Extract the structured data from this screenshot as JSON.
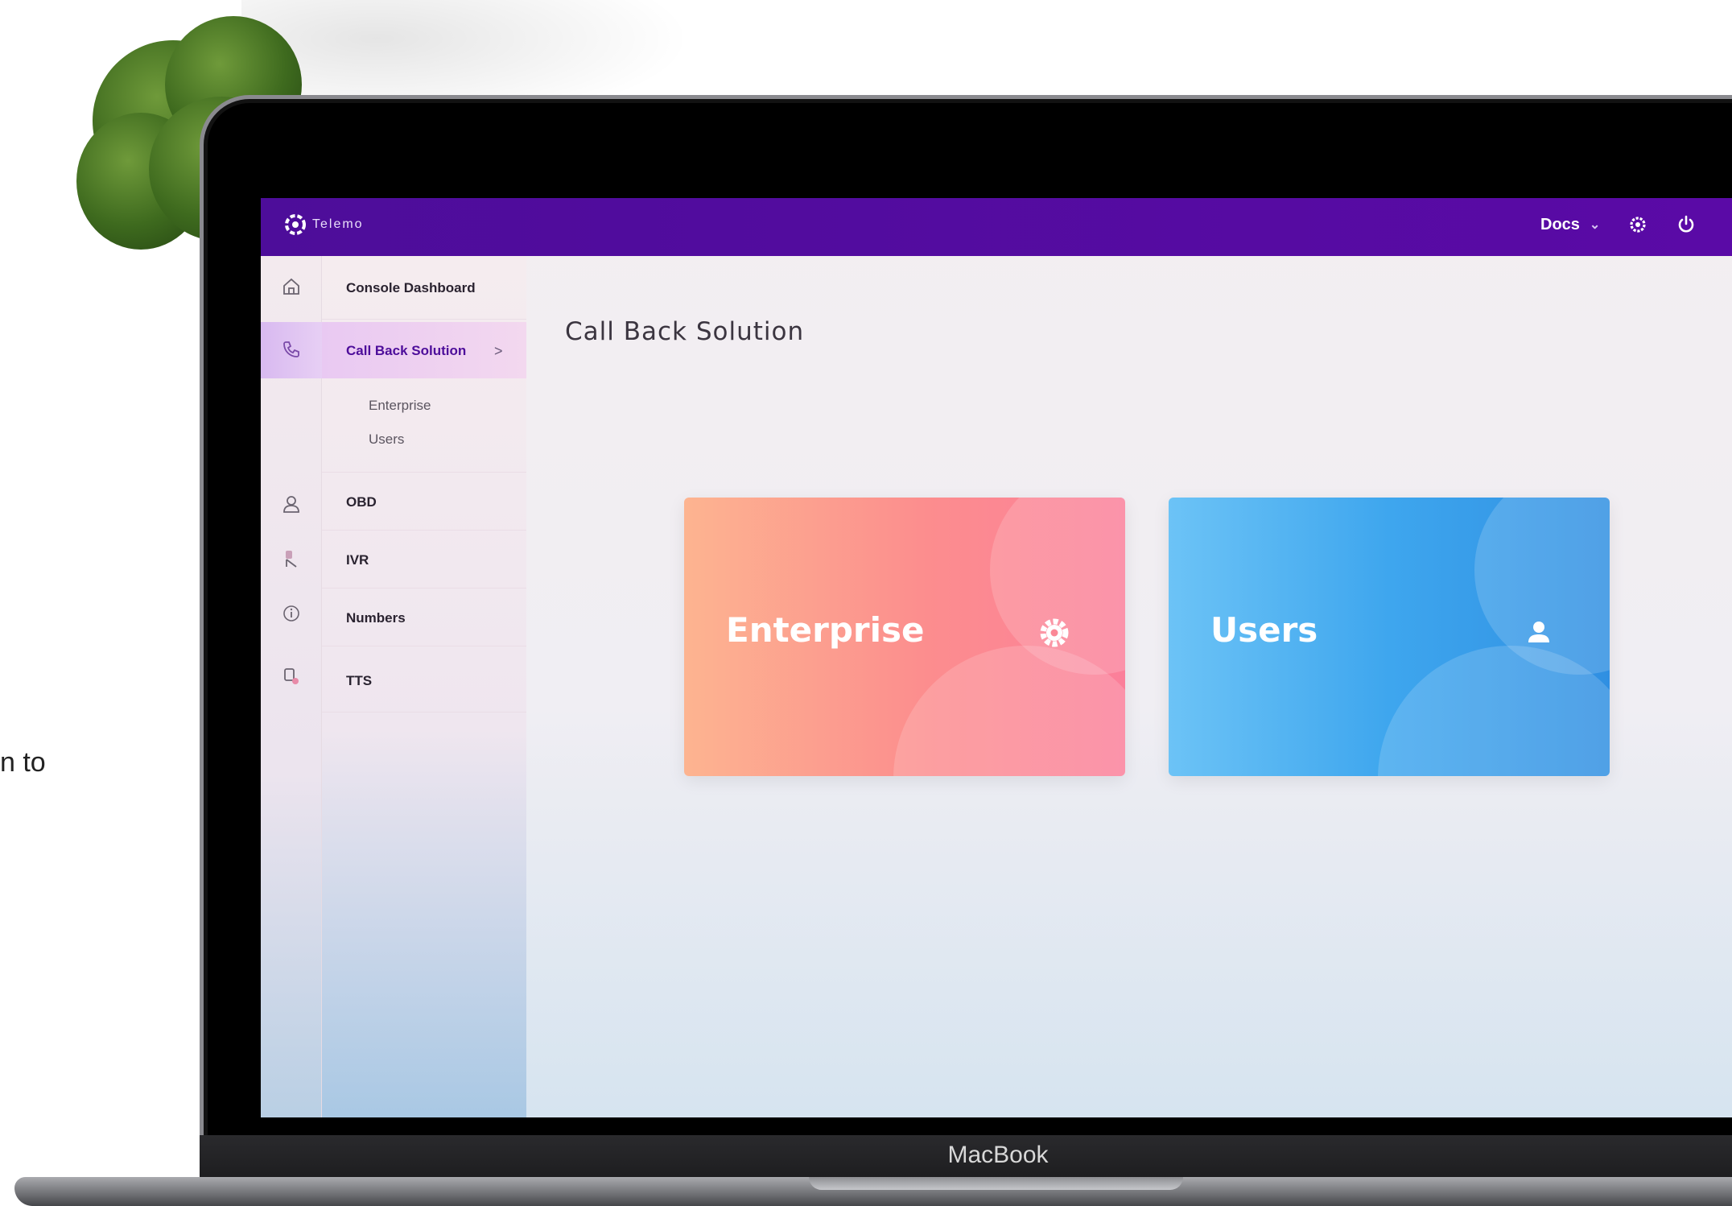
{
  "app": {
    "brand_name": "Telemo",
    "docs_label": "Docs",
    "device_label": "MacBook",
    "background_partial_text": "n to"
  },
  "sidebar": {
    "items": [
      {
        "label": "Console Dashboard",
        "icon": "home-icon"
      },
      {
        "label": "Call Back Solution",
        "icon": "phone-icon",
        "active": true,
        "arrow": ">"
      },
      {
        "label": "OBD",
        "icon": "agent-icon"
      },
      {
        "label": "IVR",
        "icon": "ivr-icon"
      },
      {
        "label": "Numbers",
        "icon": "info-icon"
      },
      {
        "label": "TTS",
        "icon": "tts-icon"
      }
    ],
    "sub_items": [
      "Enterprise",
      "Users"
    ]
  },
  "main": {
    "title": "Call Back Solution",
    "cards": [
      {
        "label": "Enterprise",
        "icon": "gear-icon",
        "color": "#fc8d8e"
      },
      {
        "label": "Users",
        "icon": "user-icon",
        "color": "#3ea6ee"
      }
    ]
  },
  "colors": {
    "topbar": "#5a0aa6",
    "accent": "#4d0d9a"
  }
}
